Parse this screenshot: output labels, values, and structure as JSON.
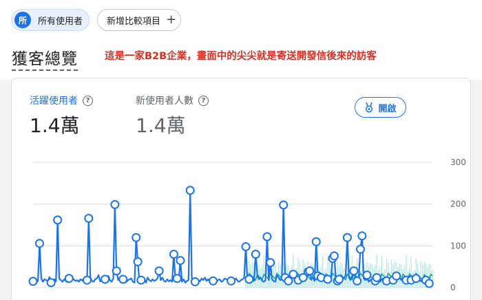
{
  "filters": {
    "all_users_badge": "所",
    "all_users_label": "所有使用者",
    "add_comparison_label": "新增比較項目",
    "add_icon": "plus-icon"
  },
  "header": {
    "title": "獲客總覽",
    "annotation": "這是一家B2B企業，畫面中的尖尖就是寄送開發信後來的訪客"
  },
  "metrics": [
    {
      "label": "活躍使用者",
      "value": "1.4萬",
      "help_glyph": "?"
    },
    {
      "label": "新使用者人數",
      "value": "1.4萬",
      "help_glyph": "?"
    }
  ],
  "insights_button": {
    "label": "開啟",
    "icon": "insights-badge-icon"
  },
  "colors": {
    "primary": "#1a73e8",
    "secondary_series": "#1fa19a",
    "band": "#a6e3df",
    "annotation": "#d93025"
  },
  "chart_data": {
    "type": "line",
    "yticks": [
      0,
      100,
      200,
      300
    ],
    "ylim": [
      0,
      300
    ],
    "grid": true,
    "series": [
      {
        "values": [
          15,
          18,
          12,
          16,
          106,
          22,
          14,
          20,
          18,
          16,
          25,
          12,
          18,
          20,
          15,
          162,
          22,
          18,
          14,
          20,
          16,
          13,
          22,
          18,
          25,
          19,
          16,
          18,
          14,
          20,
          17,
          22,
          15,
          18,
          166,
          24,
          16,
          14,
          20,
          22,
          30,
          15,
          18,
          14,
          20,
          24,
          28,
          18,
          14,
          22,
          199,
          40,
          18,
          24,
          16,
          20,
          12,
          14,
          18,
          20,
          22,
          14,
          12,
          120,
          62,
          15,
          18,
          16,
          22,
          12,
          24,
          18,
          15,
          20,
          16,
          18,
          22,
          40,
          18,
          24,
          16,
          14,
          20,
          15,
          18,
          14,
          80,
          16,
          22,
          18,
          65,
          14,
          20,
          12,
          16,
          18,
          233,
          22,
          16,
          14,
          20,
          18,
          15,
          22,
          18,
          24,
          16,
          20,
          14,
          18,
          16,
          22,
          15,
          18,
          20,
          14,
          16,
          22,
          20,
          18,
          14,
          16,
          20,
          18,
          22,
          16,
          14,
          18,
          20,
          24,
          98,
          14,
          20,
          18,
          22,
          16,
          80,
          30,
          20,
          24,
          16,
          14,
          18,
          122,
          18,
          60,
          20,
          16,
          14,
          30,
          24,
          18,
          20,
          198,
          24,
          18,
          16,
          14,
          28,
          32,
          16,
          22,
          18,
          20,
          30,
          24,
          18,
          22,
          38,
          40,
          20,
          24,
          16,
          110,
          28,
          20,
          24,
          18,
          16,
          22,
          20,
          18,
          24,
          70,
          76,
          22,
          16,
          20,
          18,
          24,
          22,
          30,
          120,
          24,
          18,
          28,
          40,
          20,
          16,
          24,
          92,
          124,
          22,
          18,
          30,
          14,
          18,
          20,
          22,
          16,
          24,
          18,
          14,
          20,
          22,
          18,
          16,
          24,
          20,
          22,
          18,
          16,
          28,
          20,
          24,
          18,
          22,
          20,
          18,
          24,
          28,
          18,
          20,
          16,
          22,
          24,
          18,
          15,
          22,
          20,
          18,
          14,
          10,
          12,
          18
        ]
      },
      {
        "values": [
          0,
          0,
          0,
          0,
          0,
          0,
          0,
          0,
          0,
          0,
          0,
          0,
          0,
          0,
          0,
          0,
          0,
          0,
          0,
          0,
          0,
          0,
          0,
          0,
          0,
          0,
          0,
          0,
          0,
          0,
          0,
          0,
          0,
          0,
          0,
          0,
          0,
          0,
          0,
          0,
          0,
          0,
          0,
          0,
          0,
          0,
          0,
          0,
          0,
          0,
          0,
          0,
          0,
          0,
          0,
          0,
          0,
          0,
          0,
          0,
          0,
          0,
          0,
          0,
          0,
          0,
          0,
          0,
          0,
          0,
          0,
          0,
          0,
          0,
          0,
          0,
          0,
          0,
          0,
          0,
          0,
          0,
          0,
          0,
          0,
          0,
          0,
          0,
          0,
          0,
          0,
          0,
          0,
          0,
          0,
          0,
          0,
          0,
          0,
          0,
          0,
          0,
          0,
          0,
          0,
          0,
          0,
          0,
          0,
          0,
          0,
          0,
          0,
          0,
          0,
          0,
          0,
          0,
          0,
          0,
          0,
          0,
          0,
          0,
          0,
          0,
          0,
          0,
          0,
          0,
          0,
          0,
          0,
          0,
          0,
          0,
          0,
          0,
          0,
          0,
          0,
          0,
          0,
          0,
          0,
          0,
          0,
          0,
          0,
          0,
          0,
          0,
          0,
          0,
          0,
          0,
          0,
          0,
          0,
          0,
          0,
          0,
          0,
          0,
          0,
          0,
          0,
          0,
          0,
          0,
          0,
          0,
          0,
          0,
          0,
          0,
          0,
          0,
          0,
          0,
          0,
          0,
          0,
          0,
          0,
          0,
          0,
          0,
          0,
          0,
          0,
          0,
          0,
          0,
          0,
          0,
          0,
          0,
          0,
          0,
          0,
          0,
          0,
          0,
          0,
          0,
          0,
          0,
          0,
          0,
          0,
          0,
          0,
          0,
          0,
          0,
          0,
          0,
          0,
          0,
          0,
          0,
          0,
          0,
          0,
          0,
          0,
          0,
          0,
          0,
          0,
          0,
          0,
          0,
          0,
          0,
          0,
          0,
          0,
          0,
          0,
          0,
          0,
          0,
          0,
          0,
          0,
          0,
          0
        ]
      },
      {
        "values": []
      }
    ],
    "marker_threshold": 30
  }
}
